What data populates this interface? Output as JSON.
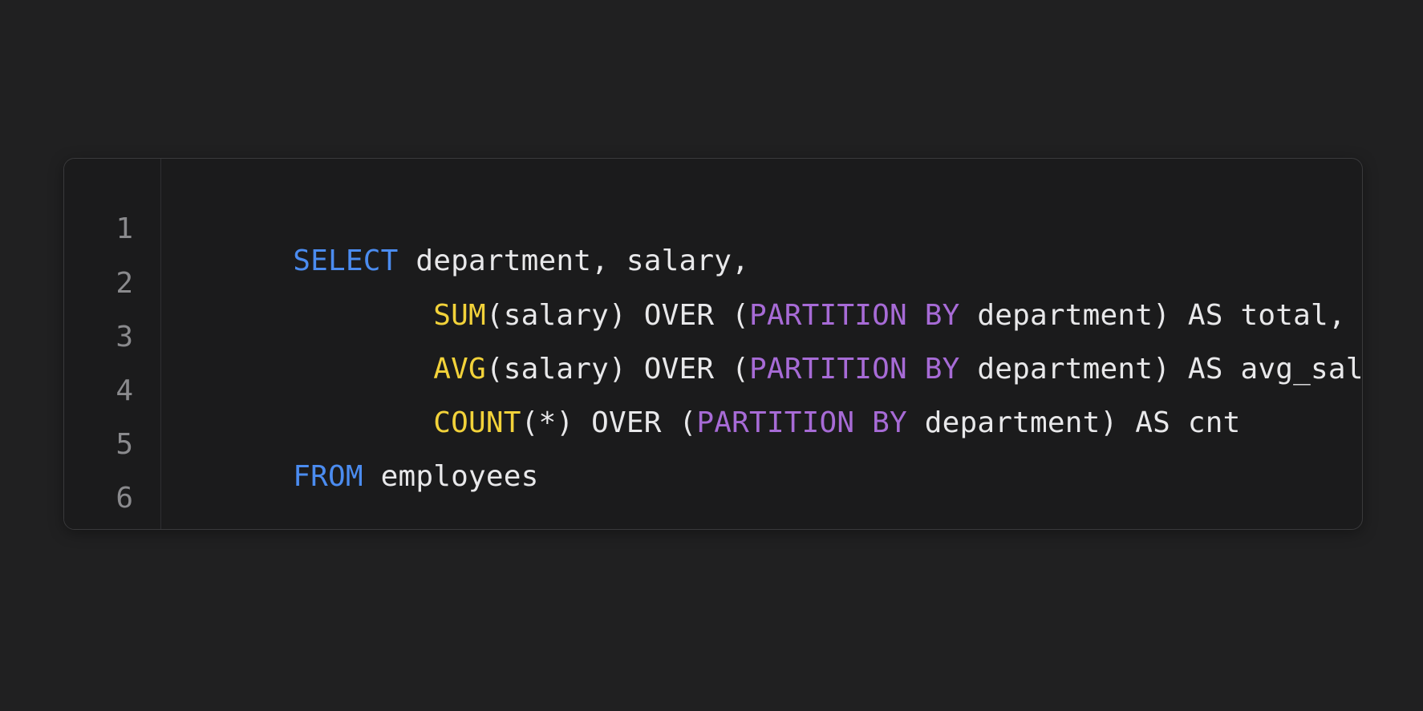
{
  "editor": {
    "line_numbers": [
      "1",
      "2",
      "3",
      "4",
      "5",
      "6"
    ],
    "lines": [
      [
        {
          "text": "SELECT",
          "kind": "keyword"
        },
        {
          "text": " department, salary,",
          "kind": "plain"
        }
      ],
      [
        {
          "text": "        ",
          "kind": "plain"
        },
        {
          "text": "SUM",
          "kind": "function"
        },
        {
          "text": "(salary) OVER (",
          "kind": "plain"
        },
        {
          "text": "PARTITION BY",
          "kind": "partition"
        },
        {
          "text": " department) AS total,",
          "kind": "plain"
        }
      ],
      [
        {
          "text": "        ",
          "kind": "plain"
        },
        {
          "text": "AVG",
          "kind": "function"
        },
        {
          "text": "(salary) OVER (",
          "kind": "plain"
        },
        {
          "text": "PARTITION BY",
          "kind": "partition"
        },
        {
          "text": " department) AS avg_sal,",
          "kind": "plain"
        }
      ],
      [
        {
          "text": "        ",
          "kind": "plain"
        },
        {
          "text": "COUNT",
          "kind": "function"
        },
        {
          "text": "(*) OVER (",
          "kind": "plain"
        },
        {
          "text": "PARTITION BY",
          "kind": "partition"
        },
        {
          "text": " department) AS cnt",
          "kind": "plain"
        }
      ],
      [
        {
          "text": "FROM",
          "kind": "keyword"
        },
        {
          "text": " employees",
          "kind": "plain"
        }
      ],
      []
    ]
  },
  "colors": {
    "background": "#202021",
    "panel": "#1b1b1c",
    "keyword": "#4b8cf0",
    "function": "#f2d23a",
    "partition": "#a76bd6",
    "text": "#e8e8ea",
    "line_number": "#8a8a8d"
  }
}
